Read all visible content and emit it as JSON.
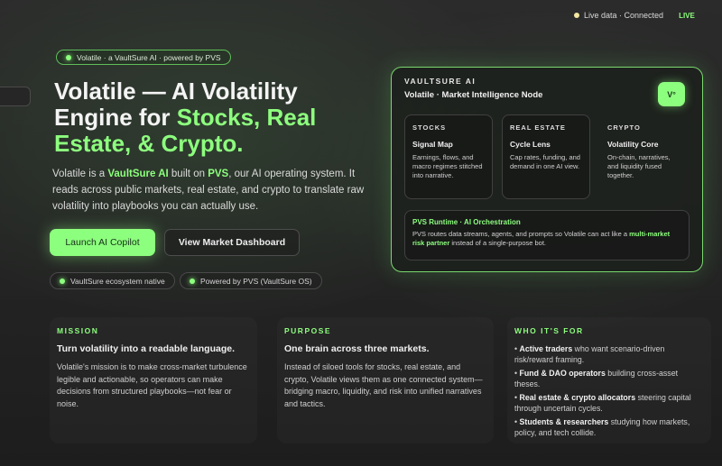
{
  "status": {
    "text": "Live data · Connected",
    "live_label": "LIVE"
  },
  "badge": {
    "text": "Volatile · a VaultSure AI · powered by PVS"
  },
  "hero": {
    "title_main": "Volatile — AI Volatility Engine for ",
    "title_accent": "Stocks, Real Estate, & Crypto.",
    "desc_p1": "Volatile is a ",
    "desc_brand1": "VaultSure AI",
    "desc_p2": " built on ",
    "desc_brand2": "PVS",
    "desc_p3": ", our AI operating system. It reads across public markets, real estate, and crypto to translate raw volatility into playbooks you can actually use."
  },
  "buttons": {
    "primary": "Launch AI Copilot",
    "secondary": "View Market Dashboard"
  },
  "chips": [
    "VaultSure ecosystem native",
    "Powered by PVS (VaultSure OS)"
  ],
  "card": {
    "eyebrow": "VAULTSURE AI",
    "title": "Volatile · Market Intelligence Node",
    "badge": "V°",
    "markets": [
      {
        "eyebrow": "STOCKS",
        "title": "Signal Map",
        "text": "Earnings, flows, and macro regimes stitched into narrative."
      },
      {
        "eyebrow": "REAL ESTATE",
        "title": "Cycle Lens",
        "text": "Cap rates, funding, and demand in one AI view."
      },
      {
        "eyebrow": "CRYPTO",
        "title": "Volatility Core",
        "text": "On-chain, narratives, and liquidity fused together."
      }
    ],
    "runtime": {
      "title": "PVS Runtime · AI Orchestration",
      "text_p1": "PVS routes data streams, agents, and prompts so Volatile can act like a ",
      "text_accent": "multi-market risk partner",
      "text_p2": " instead of a single-purpose bot."
    }
  },
  "mission": {
    "eyebrow": "MISSION",
    "heading": "Turn volatility into a readable language.",
    "text": "Volatile's mission is to make cross-market turbulence legible and actionable, so operators can make decisions from structured playbooks—not fear or noise."
  },
  "purpose": {
    "eyebrow": "PURPOSE",
    "heading": "One brain across three markets.",
    "text": "Instead of siloed tools for stocks, real estate, and crypto, Volatile views them as one connected system—bridging macro, liquidity, and risk into unified narratives and tactics."
  },
  "audience": {
    "eyebrow": "WHO IT'S FOR",
    "items": [
      {
        "bold": "Active traders",
        "rest": " who want scenario-driven risk/reward framing."
      },
      {
        "bold": "Fund & DAO operators",
        "rest": " building cross-asset theses."
      },
      {
        "bold": "Real estate & crypto allocators",
        "rest": " steering capital through uncertain cycles."
      },
      {
        "bold": "Students & researchers",
        "rest": " studying how markets, policy, and tech collide."
      }
    ]
  },
  "colors": {
    "accent": "#8dff7e",
    "background": "#262626"
  }
}
